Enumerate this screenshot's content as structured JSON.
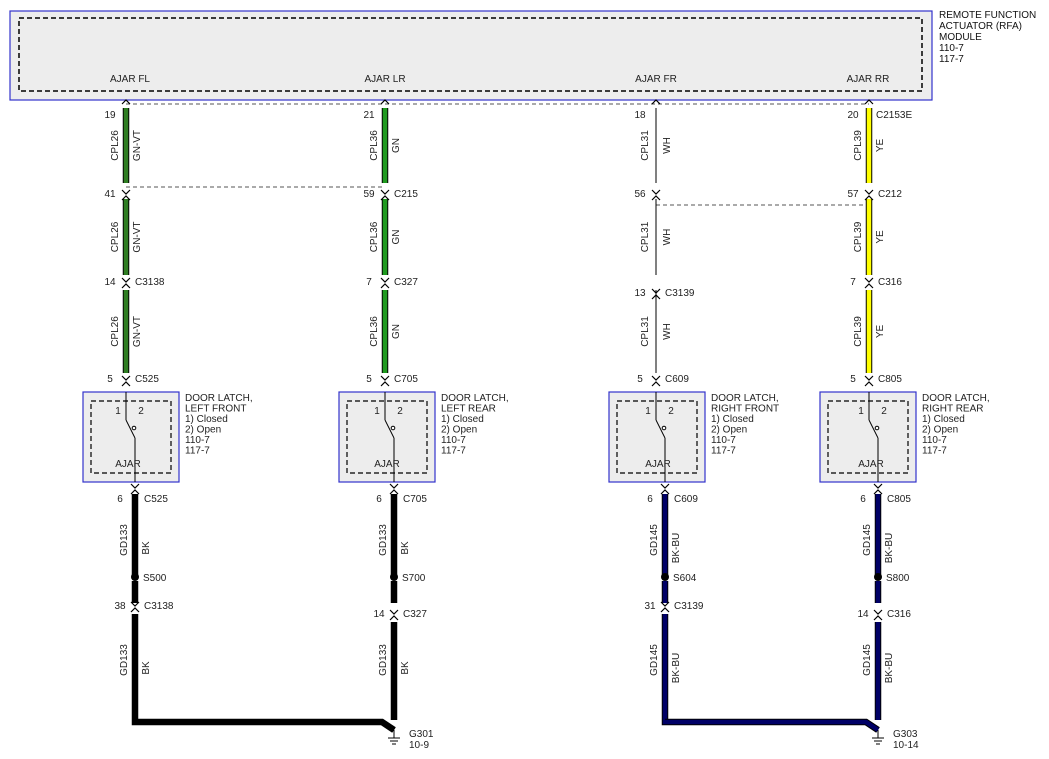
{
  "module": {
    "title_lines": [
      "REMOTE FUNCTION",
      "ACTUATOR (RFA)",
      "MODULE",
      "110-7",
      "117-7"
    ]
  },
  "pins": [
    "AJAR FL",
    "AJAR LR",
    "AJAR FR",
    "AJAR RR"
  ],
  "colors": {
    "GN-VT": "#2e7d22",
    "GN": "#1f9a1f",
    "WH": "#ffffff",
    "YE": "#ffff00",
    "BK": "#000000",
    "BK-BU": "#000066",
    "module_border": "#3333cc",
    "module_fill": "#ededed"
  },
  "columns": [
    {
      "id": "fl",
      "module_pin": "19",
      "module_connector": "",
      "upper_segments": [
        {
          "circuit": "CPL26",
          "color": "GN-VT"
        },
        {
          "circuit": "CPL26",
          "color": "GN-VT"
        },
        {
          "circuit": "CPL26",
          "color": "GN-VT"
        }
      ],
      "upper_connectors": [
        {
          "pin": "41",
          "name": ""
        },
        {
          "pin": "14",
          "name": "C3138"
        }
      ],
      "latch_connector_top": {
        "pin": "5",
        "name": "C525"
      },
      "latch": {
        "lines": [
          "DOOR LATCH,",
          "LEFT FRONT",
          "1) Closed",
          "2) Open",
          "110-7",
          "117-7"
        ],
        "switch_pins": [
          "1",
          "2"
        ],
        "label": "AJAR"
      },
      "latch_connector_bottom": {
        "pin": "6",
        "name": "C525"
      },
      "splice": "S500",
      "lower_segments": [
        {
          "circuit": "GD133",
          "color": "BK"
        },
        {
          "circuit": "GD133",
          "color": "BK"
        }
      ],
      "lower_connector": {
        "pin": "38",
        "name": "C3138"
      }
    },
    {
      "id": "lr",
      "module_pin": "21",
      "module_connector": "",
      "upper_segments": [
        {
          "circuit": "CPL36",
          "color": "GN"
        },
        {
          "circuit": "CPL36",
          "color": "GN"
        },
        {
          "circuit": "CPL36",
          "color": "GN"
        }
      ],
      "upper_connectors": [
        {
          "pin": "59",
          "name": "C215"
        },
        {
          "pin": "7",
          "name": "C327"
        }
      ],
      "latch_connector_top": {
        "pin": "5",
        "name": "C705"
      },
      "latch": {
        "lines": [
          "DOOR LATCH,",
          "LEFT REAR",
          "1) Closed",
          "2) Open",
          "110-7",
          "117-7"
        ],
        "switch_pins": [
          "1",
          "2"
        ],
        "label": "AJAR"
      },
      "latch_connector_bottom": {
        "pin": "6",
        "name": "C705"
      },
      "splice": "S700",
      "lower_segments": [
        {
          "circuit": "GD133",
          "color": "BK"
        },
        {
          "circuit": "GD133",
          "color": "BK"
        }
      ],
      "lower_connector": {
        "pin": "14",
        "name": "C327"
      }
    },
    {
      "id": "fr",
      "module_pin": "18",
      "module_connector": "",
      "upper_segments": [
        {
          "circuit": "CPL31",
          "color": "WH"
        },
        {
          "circuit": "CPL31",
          "color": "WH"
        },
        {
          "circuit": "CPL31",
          "color": "WH"
        }
      ],
      "upper_connectors": [
        {
          "pin": "56",
          "name": ""
        },
        {
          "pin": "13",
          "name": "C3139"
        }
      ],
      "latch_connector_top": {
        "pin": "5",
        "name": "C609"
      },
      "latch": {
        "lines": [
          "DOOR LATCH,",
          "RIGHT FRONT",
          "1) Closed",
          "2) Open",
          "110-7",
          "117-7"
        ],
        "switch_pins": [
          "1",
          "2"
        ],
        "label": "AJAR"
      },
      "latch_connector_bottom": {
        "pin": "6",
        "name": "C609"
      },
      "splice": "S604",
      "lower_segments": [
        {
          "circuit": "GD145",
          "color": "BK-BU"
        },
        {
          "circuit": "GD145",
          "color": "BK-BU"
        }
      ],
      "lower_connector": {
        "pin": "31",
        "name": "C3139"
      }
    },
    {
      "id": "rr",
      "module_pin": "20",
      "module_connector": "C2153E",
      "upper_segments": [
        {
          "circuit": "CPL39",
          "color": "YE"
        },
        {
          "circuit": "CPL39",
          "color": "YE"
        },
        {
          "circuit": "CPL39",
          "color": "YE"
        }
      ],
      "upper_connectors": [
        {
          "pin": "57",
          "name": "C212"
        },
        {
          "pin": "7",
          "name": "C316"
        }
      ],
      "latch_connector_top": {
        "pin": "5",
        "name": "C805"
      },
      "latch": {
        "lines": [
          "DOOR LATCH,",
          "RIGHT REAR",
          "1) Closed",
          "2) Open",
          "110-7",
          "117-7"
        ],
        "switch_pins": [
          "1",
          "2"
        ],
        "label": "AJAR"
      },
      "latch_connector_bottom": {
        "pin": "6",
        "name": "C805"
      },
      "splice": "S800",
      "lower_segments": [
        {
          "circuit": "GD145",
          "color": "BK-BU"
        },
        {
          "circuit": "GD145",
          "color": "BK-BU"
        }
      ],
      "lower_connector": {
        "pin": "14",
        "name": "C316"
      }
    }
  ],
  "grounds": [
    {
      "name": "G301",
      "ref": "10-9",
      "color": "BK"
    },
    {
      "name": "G303",
      "ref": "10-14",
      "color": "BK-BU"
    }
  ]
}
